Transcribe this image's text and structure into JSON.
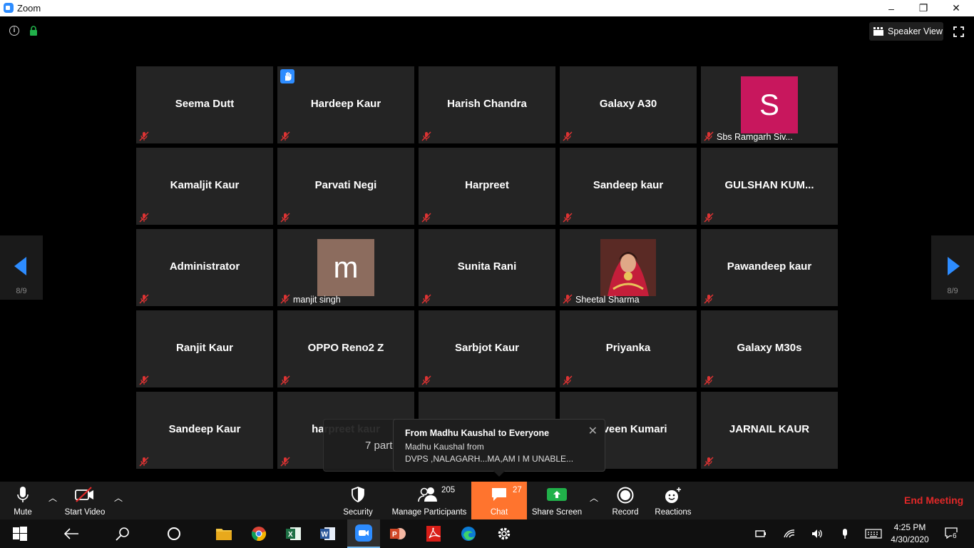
{
  "window": {
    "title": "Zoom",
    "minimize": "–",
    "maximize": "❐",
    "close": "✕"
  },
  "top_bar": {
    "view_label": "Speaker View"
  },
  "navigation": {
    "prev_page": "8/9",
    "next_page": "8/9"
  },
  "tiles": [
    {
      "name": "Seema Dutt"
    },
    {
      "name": "Hardeep Kaur",
      "hand_raised": true
    },
    {
      "name": "Harish Chandra"
    },
    {
      "name": "Galaxy A30"
    },
    {
      "name": "Sbs Ramgarh Siv...",
      "avatar": "S",
      "avatar_color": "#c8175d"
    },
    {
      "name": "Kamaljit Kaur"
    },
    {
      "name": "Parvati Negi"
    },
    {
      "name": "Harpreet"
    },
    {
      "name": "Sandeep kaur"
    },
    {
      "name": "GULSHAN  KUM..."
    },
    {
      "name": "Administrator"
    },
    {
      "name": "manjit singh",
      "avatar": "m",
      "avatar_color": "#8c6c5e"
    },
    {
      "name": "Sunita Rani"
    },
    {
      "name": "Sheetal Sharma",
      "photo": true
    },
    {
      "name": "Pawandeep kaur"
    },
    {
      "name": "Ranjit Kaur"
    },
    {
      "name": "OPPO Reno2 Z"
    },
    {
      "name": "Sarbjot Kaur"
    },
    {
      "name": "Priyanka"
    },
    {
      "name": "Galaxy M30s"
    },
    {
      "name": "Sandeep Kaur"
    },
    {
      "name": "harpreet kaur"
    },
    {
      "name": ""
    },
    {
      "name": "Naveen Kumari"
    },
    {
      "name": "JARNAIL KAUR"
    }
  ],
  "participants_popup": {
    "text": "7 part"
  },
  "chat_popup": {
    "from": "From Madhu Kaushal to Everyone",
    "line1": "Madhu Kaushal from",
    "line2": "DVPS ,NALAGARH...MA,AM I M UNABLE..."
  },
  "toolbar": {
    "mute": "Mute",
    "start_video": "Start Video",
    "security": "Security",
    "manage_participants": "Manage Participants",
    "participants_count": "205",
    "chat": "Chat",
    "chat_count": "27",
    "share_screen": "Share Screen",
    "record": "Record",
    "reactions": "Reactions",
    "end_meeting": "End Meeting"
  },
  "taskbar": {
    "time": "4:25 PM",
    "date": "4/30/2020",
    "notifications": "6",
    "apps": [
      "start-icon",
      "back-icon",
      "search-icon",
      "cortana-icon",
      "file-explorer-icon",
      "chrome-icon",
      "excel-icon",
      "word-icon",
      "zoom-icon",
      "powerpoint-icon",
      "acrobat-icon",
      "edge-icon",
      "settings-icon"
    ]
  },
  "colors": {
    "accent": "#2d8cff",
    "chat_active": "#ff742e",
    "end_meeting": "#e02828",
    "share_green": "#21b14a"
  }
}
